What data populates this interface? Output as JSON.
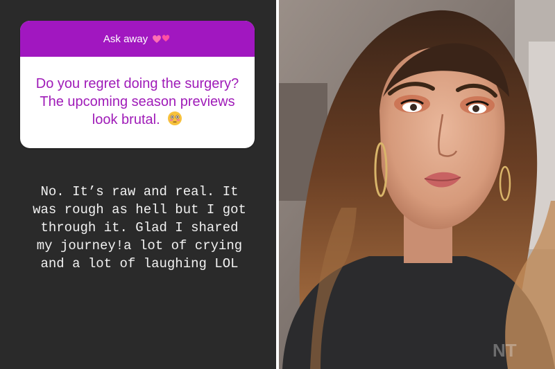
{
  "question_card": {
    "header_label": "Ask away",
    "header_icon": "two-hearts-icon",
    "question_text": "Do you regret doing the surgery? The upcoming season previews look brutal.",
    "question_icon": "flushed-face-icon",
    "header_color": "#a117c0",
    "text_color": "#9f1bb8"
  },
  "answer_text": "No. It’s raw and real. It\nwas rough as hell but I got\nthrough it. Glad I shared\nmy journey!a lot of crying\nand a lot of laughing LOL",
  "colors": {
    "story_background": "#2a2a2a"
  }
}
